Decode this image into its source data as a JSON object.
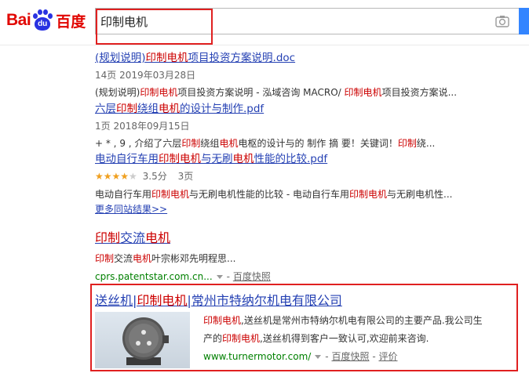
{
  "header": {
    "logo": {
      "bai": "Bai",
      "du": "du",
      "cn": "百度"
    },
    "search": {
      "query": "印制电机"
    },
    "icons": {
      "camera": "camera-icon"
    }
  },
  "results": [
    {
      "title_pre": "(规划说明)",
      "title_em": "印制电机",
      "title_post": "项目投资方案说明.doc",
      "meta": "14页   2019年03月28日",
      "abs_pre": "(规划说明)",
      "abs_em": "印制电机",
      "abs_post": "项目投资方案说明 - 泓域咨询 MACRO/ ",
      "abs_em2": "印制电机",
      "abs_post2": "项目投资方案说..."
    },
    {
      "title_pre": "六层",
      "title_em": "印制",
      "title_mid": "绕组",
      "title_em2": "电机",
      "title_post": "的设计与制作.pdf",
      "meta": "1页   2018年09月15日",
      "abs_pre": "+ * , 9 , 介绍了六层",
      "abs_em": "印制",
      "abs_mid": "绕组",
      "abs_em2": "电机",
      "abs_post": "电枢的设计与的 制作 摘 要！关键词！",
      "abs_em3": "印制",
      "abs_post2": "绕..."
    },
    {
      "title_pre": "电动自行车用",
      "title_em": "印制电机",
      "title_mid": "与无刷",
      "title_em2": "电机",
      "title_post": "性能的比较.pdf",
      "rating": "3.5分",
      "pages": "3页",
      "abs_pre": "电动自行车用",
      "abs_em": "印制电机",
      "abs_mid": "与无刷电机性能的比较 - 电动自行车用",
      "abs_em2": "印制电机",
      "abs_post": "与无刷电机性..."
    }
  ],
  "more_link": "更多同站结果>>",
  "result4": {
    "title_em": "印制",
    "title_mid": "交流",
    "title_em2": "电机",
    "abs_em": "印制",
    "abs_mid": "交流",
    "abs_em2": "电机",
    "abs_post": "叶宗彬邓先明程思...",
    "url": "cprs.patentstar.com.cn...",
    "snapshot": "百度快照",
    "sep": "-"
  },
  "result5": {
    "title_pre": "送丝机|",
    "title_em": "印制电机",
    "title_post": "|常州市特纳尔机电有限公司",
    "abs1_em": "印制电机",
    "abs1_post": ",送丝机是常州市特纳尔机电有限公司的主要产品.我公司生",
    "abs2_pre": "产的",
    "abs2_em": "印制电机",
    "abs2_post": ",送丝机得到客户一致认可,欢迎前来咨询.",
    "url": "www.turnermotor.com/",
    "snapshot": "百度快照",
    "review": "评价",
    "sep": "-"
  }
}
